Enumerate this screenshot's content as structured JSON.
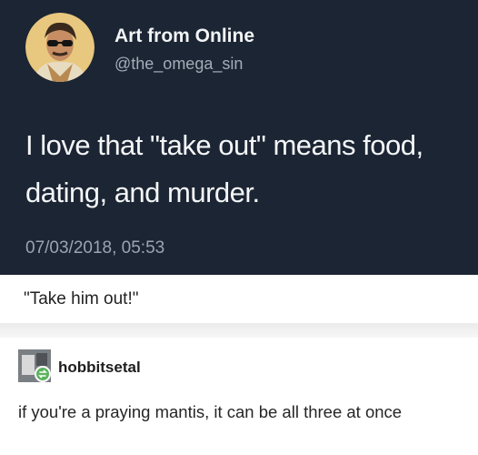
{
  "tweet": {
    "display_name": "Art from Online",
    "handle": "@the_omega_sin",
    "text": "I love that \"take out\" means food, dating, and murder.",
    "timestamp": "07/03/2018, 05:53",
    "avatar_icon": "man-with-sunglasses-avatar",
    "background": "#1c2533"
  },
  "post": {
    "caption": "\"Take him out!\""
  },
  "reblog": {
    "username": "hobbitsetal",
    "reply_text": "if you're a praying mantis, it can be all three at once",
    "avatar_icon": "user-avatar",
    "badge_icon": "reblog-icon",
    "badge_color": "#5cb35c"
  }
}
